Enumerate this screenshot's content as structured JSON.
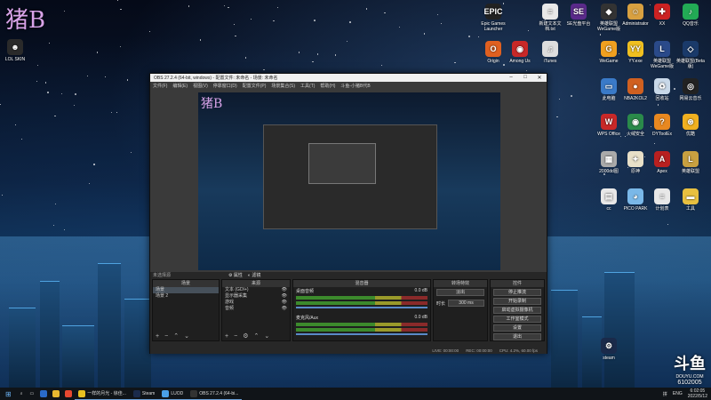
{
  "watermark": "猪B",
  "desktop_left": [
    {
      "label": "LOL SKIN",
      "color": "#2a2a2a",
      "glyph": "☻"
    }
  ],
  "desktop_top": [
    {
      "label": "Epic Games Launcher",
      "color": "#222",
      "glyph": "EPIC"
    },
    {
      "label": "新建文本文档.txt",
      "color": "#e8e8e8",
      "glyph": "≡"
    },
    {
      "label": "SE光盘平台",
      "color": "#5a2a8a",
      "glyph": "SE"
    },
    {
      "label": "英雄联盟WeGame版",
      "color": "#333",
      "glyph": "◆"
    },
    {
      "label": "Administrator",
      "color": "#d8a040",
      "glyph": "☺"
    },
    {
      "label": "XX",
      "color": "#cc2222",
      "glyph": "✚"
    },
    {
      "label": "QQ音乐",
      "color": "#22aa55",
      "glyph": "♪"
    }
  ],
  "desktop_row2": [
    {
      "label": "Origin",
      "color": "#e06020",
      "glyph": "O"
    },
    {
      "label": "Among Us",
      "color": "#c82828",
      "glyph": "◉"
    },
    {
      "label": "iTunes",
      "color": "#ddd",
      "glyph": "♫"
    },
    {
      "label": "WeGame",
      "color": "#f0a020",
      "glyph": "G"
    },
    {
      "label": "YY.exe",
      "color": "#f0c020",
      "glyph": "YY"
    },
    {
      "label": "英雄联盟WeGame版",
      "color": "#2a4a8a",
      "glyph": "L"
    },
    {
      "label": "英雄联盟(Beta版)",
      "color": "#1a3a6a",
      "glyph": "◇"
    }
  ],
  "desktop_right": [
    {
      "label": "此电脑",
      "color": "#3a7ac8",
      "glyph": "▭"
    },
    {
      "label": "NBA2KOL2",
      "color": "#d06020",
      "glyph": "●"
    },
    {
      "label": "回收站",
      "color": "#c8d8e8",
      "glyph": "♻"
    },
    {
      "label": "网易云音乐",
      "color": "#222",
      "glyph": "◎"
    },
    {
      "label": "WPS Office",
      "color": "#c82828",
      "glyph": "W"
    },
    {
      "label": "火绒安全",
      "color": "#2a8a4a",
      "glyph": "◉"
    },
    {
      "label": "DYToolEx",
      "color": "#e88820",
      "glyph": "?"
    },
    {
      "label": "优酷",
      "color": "#f0b020",
      "glyph": "⊛"
    },
    {
      "label": "2000dd图",
      "color": "#aaa",
      "glyph": "▦"
    },
    {
      "label": "原神",
      "color": "#e8e0c8",
      "glyph": "✦"
    },
    {
      "label": "Apex",
      "color": "#b82020",
      "glyph": "A"
    },
    {
      "label": "英雄联盟",
      "color": "#c8a040",
      "glyph": "L"
    },
    {
      "label": "cc",
      "color": "#e8e8e8",
      "glyph": "▤"
    },
    {
      "label": "PICO PARK",
      "color": "#7ab8e8",
      "glyph": "◕"
    },
    {
      "label": "计划表",
      "color": "#e8e8e8",
      "glyph": "≡"
    },
    {
      "label": "工具",
      "color": "#e8c040",
      "glyph": "▬"
    },
    {
      "label": "steam",
      "color": "#1a2a4a",
      "glyph": "⚙"
    }
  ],
  "obs": {
    "title": "OBS 27.2.4 (64-bit, windows) - 配置文件: 未命名 - 场景: 未命名",
    "menu": [
      "文件(F)",
      "编辑(E)",
      "视图(V)",
      "停靠窗口(D)",
      "配置文件(P)",
      "场景集合(S)",
      "工具(T)",
      "帮助(H)",
      "斗鱼-小猪B代B"
    ],
    "preview_watermark": "猪B",
    "no_source": "未选择源",
    "props_btn": "属性",
    "filter_btn": "滤镜",
    "panels": {
      "scenes": "场景",
      "sources": "来源",
      "mixer": "混音器",
      "transitions": "转场特效",
      "controls": "控件"
    },
    "scenes": [
      "场景",
      "场景 2"
    ],
    "sources": [
      "文本 (GDI+)",
      "显示器采集",
      "游戏",
      "音频"
    ],
    "mixer": [
      {
        "name": "桌面音频",
        "db": "0.0 dB"
      },
      {
        "name": "麦克风/Aux",
        "db": "0.0 dB"
      }
    ],
    "transition": {
      "type": "淡出",
      "duration_label": "时长",
      "duration": "300 ms"
    },
    "controls": [
      "停止推流",
      "开始录制",
      "启动虚拟摄像机",
      "工作室模式",
      "设置",
      "退出"
    ],
    "status": {
      "live": "LIVE: 00:00:00",
      "rec": "REC: 00:00:00",
      "cpu": "CPU: 4.2%, 60.00 fps"
    }
  },
  "taskbar": {
    "items": [
      {
        "label": "一样的月光 - 徐佳...",
        "color": "#e8c020"
      },
      {
        "label": "Steam",
        "color": "#1a2a4a"
      },
      {
        "label": "LUOD",
        "color": "#4aa0e8"
      },
      {
        "label": "OBS 27.2.4 (64-bi...",
        "color": "#333"
      }
    ],
    "tray": [
      "拼",
      "ENG"
    ],
    "time": "6:02:05",
    "date": "2022/5/12"
  },
  "douyu": {
    "logo": "斗鱼",
    "url": "DOUYU.COM",
    "room": "6102005"
  }
}
